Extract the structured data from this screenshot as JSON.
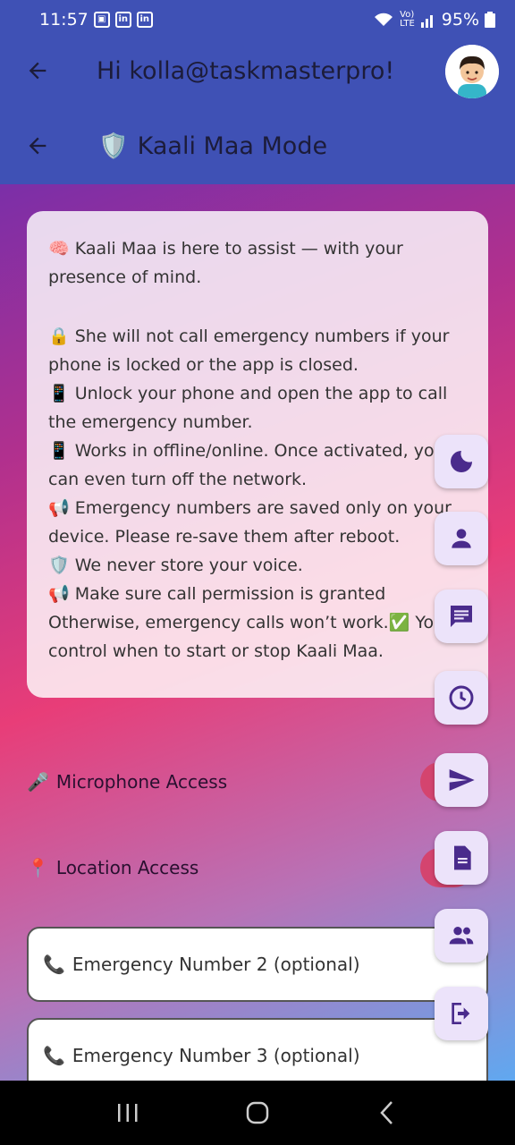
{
  "status_bar": {
    "time": "11:57",
    "battery": "95%",
    "notification_icons": [
      "gallery-icon",
      "linkedin-icon",
      "linkedin-icon"
    ]
  },
  "header": {
    "greeting": "Hi kolla@taskmasterpro!",
    "mode_title": "Kaali Maa Mode",
    "mode_emoji": "🛡️"
  },
  "info_card": {
    "lines": [
      "🧠 Kaali Maa is here to assist — with your",
      "presence of mind.",
      "",
      "🔒 She will not call emergency numbers if your",
      "phone is locked or the app is closed.",
      "📱 Unlock your phone and open the app to call",
      "the emergency number.",
      "📱 Works in offline/online. Once activated, yo",
      "can even turn off the network.",
      "📢 Emergency numbers are saved only on your",
      "device. Please re-save them after reboot.",
      "🛡️ We never store your voice.",
      "📢 Make sure call permission is granted",
      "Otherwise, emergency calls won’t work.✅ You",
      "control when to start or stop Kaali Maa."
    ]
  },
  "permissions": {
    "microphone_emoji": "🎤",
    "microphone_label": "Microphone Access",
    "location_emoji": "📍",
    "location_label": "Location Access"
  },
  "fields": {
    "phone_emoji": "📞",
    "number2_label": "Emergency Number 2 (optional)",
    "number3_label": "Emergency Number 3 (optional)"
  },
  "fab_icons": [
    "moon-icon",
    "person-icon",
    "chat-icon",
    "clock-icon",
    "send-icon",
    "document-icon",
    "group-icon",
    "logout-icon"
  ],
  "colors": {
    "appbar": "#3f51b5",
    "fab_bg": "#ece3fa",
    "fab_icon": "#4a2b8c",
    "toggle": "#d4446f"
  }
}
